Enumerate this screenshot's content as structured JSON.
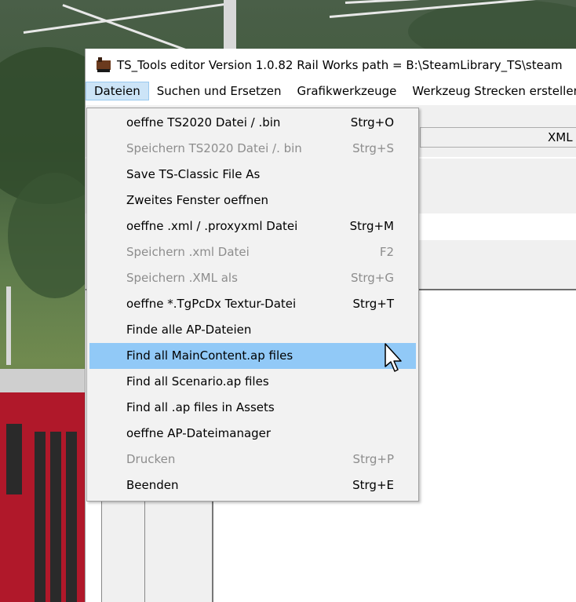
{
  "window": {
    "title": "TS_Tools editor  Version 1.0.82   Rail Works path = B:\\SteamLibrary_TS\\steam"
  },
  "menubar": {
    "items": [
      {
        "label": "Dateien",
        "active": true
      },
      {
        "label": "Suchen und Ersetzen"
      },
      {
        "label": "Grafikwerkzeuge"
      },
      {
        "label": "Werkzeug Strecken erstellen"
      }
    ]
  },
  "toolbar": {
    "xml_label": "XML"
  },
  "dropdown": {
    "items": [
      {
        "label": "oeffne TS2020 Datei / .bin",
        "shortcut": "Strg+O",
        "state": "enabled"
      },
      {
        "label": "Speichern TS2020 Datei /. bin",
        "shortcut": "Strg+S",
        "state": "disabled"
      },
      {
        "label": "Save TS-Classic File As",
        "shortcut": "",
        "state": "enabled"
      },
      {
        "label": "Zweites Fenster oeffnen",
        "shortcut": "",
        "state": "enabled"
      },
      {
        "label": "oeffne .xml / .proxyxml Datei",
        "shortcut": "Strg+M",
        "state": "enabled"
      },
      {
        "label": "Speichern .xml Datei",
        "shortcut": "F2",
        "state": "disabled"
      },
      {
        "label": "Speichern .XML als",
        "shortcut": "Strg+G",
        "state": "disabled"
      },
      {
        "label": "oeffne *.TgPcDx Textur-Datei",
        "shortcut": "Strg+T",
        "state": "enabled"
      },
      {
        "label": "Finde alle AP-Dateien",
        "shortcut": "",
        "state": "enabled"
      },
      {
        "label": "Find all MainContent.ap files",
        "shortcut": "",
        "state": "highlighted"
      },
      {
        "label": "Find all Scenario.ap files",
        "shortcut": "",
        "state": "enabled"
      },
      {
        "label": "Find all .ap files in Assets",
        "shortcut": "",
        "state": "enabled"
      },
      {
        "label": "oeffne AP-Dateimanager",
        "shortcut": "",
        "state": "enabled"
      },
      {
        "label": "Drucken",
        "shortcut": "Strg+P",
        "state": "disabled"
      },
      {
        "label": "Beenden",
        "shortcut": "Strg+E",
        "state": "enabled"
      }
    ]
  },
  "colors": {
    "menu_highlight": "#91c9f7",
    "menubar_active": "#cce4f7",
    "disabled_text": "#8d8d8d"
  }
}
